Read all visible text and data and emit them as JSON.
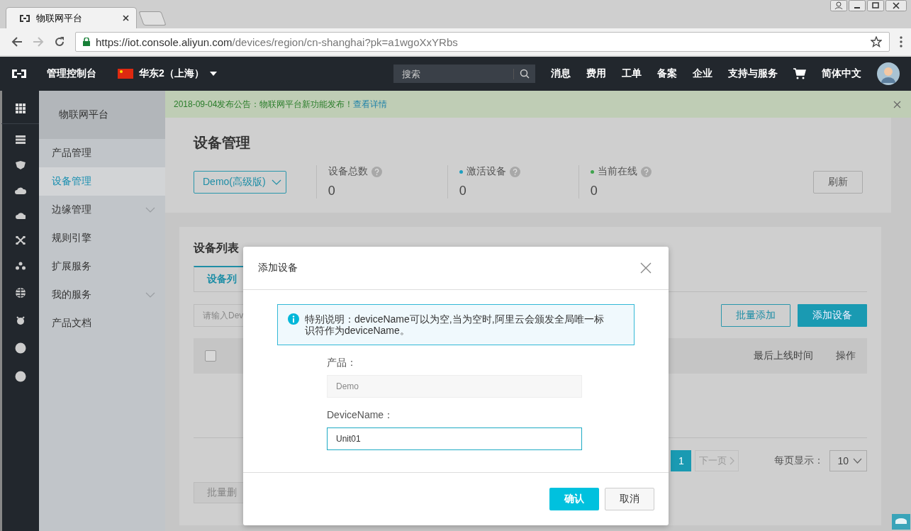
{
  "browser": {
    "tabs": [
      {
        "title": "物联网平台",
        "selected": true
      }
    ],
    "url_host": "https://iot.console.aliyun.com",
    "url_path": "/devices/region/cn-shanghai?pk=a1wgoXxYRbs"
  },
  "topbar": {
    "brand": "管理控制台",
    "region": "华东2（上海）",
    "search_placeholder": "搜索",
    "links": [
      "消息",
      "费用",
      "工单",
      "备案",
      "企业",
      "支持与服务"
    ],
    "language": "简体中文"
  },
  "sidebar": {
    "title": "物联网平台",
    "items": [
      {
        "label": "产品管理",
        "selected": false,
        "expandable": false
      },
      {
        "label": "设备管理",
        "selected": true,
        "expandable": false
      },
      {
        "label": "边缘管理",
        "selected": false,
        "expandable": true
      },
      {
        "label": "规则引擎",
        "selected": false,
        "expandable": false
      },
      {
        "label": "扩展服务",
        "selected": false,
        "expandable": false
      },
      {
        "label": "我的服务",
        "selected": false,
        "expandable": true
      },
      {
        "label": "产品文档",
        "selected": false,
        "expandable": false
      }
    ]
  },
  "notice": {
    "text": "2018-09-04发布公告：物联网平台新功能发布！",
    "link": "查看详情"
  },
  "page": {
    "title": "设备管理",
    "product": "Demo(高级版)",
    "refresh": "刷新",
    "stats": [
      {
        "label": "设备总数",
        "value": "0"
      },
      {
        "label": "激活设备",
        "value": "0",
        "color": "#1e9fc0"
      },
      {
        "label": "当前在线",
        "value": "0",
        "color": "#3fa34d"
      }
    ]
  },
  "list": {
    "title": "设备列表",
    "tabs": [
      {
        "label": "设备列",
        "selected": true
      }
    ],
    "search_placeholder": "请输入Dev",
    "batch_add": "批量添加",
    "add": "添加设备",
    "select_all": {
      "checked": false
    },
    "columns": [
      "最后上线时间",
      "操作"
    ],
    "pagination": {
      "pages": [
        {
          "label": "1",
          "selected": true
        }
      ],
      "next": "下一页",
      "page_size_label": "每页显示：",
      "page_size": "10"
    },
    "batch_delete": "批量删"
  },
  "dialog": {
    "title": "添加设备",
    "notice": "特别说明：deviceName可以为空,当为空时,阿里云会颁发全局唯一标识符作为deviceName。",
    "fields": [
      {
        "label": "产品：",
        "value": "Demo",
        "disabled": true
      },
      {
        "label": "DeviceName：",
        "value": "Unit01",
        "disabled": false
      }
    ],
    "confirm": "确认",
    "cancel": "取消"
  }
}
